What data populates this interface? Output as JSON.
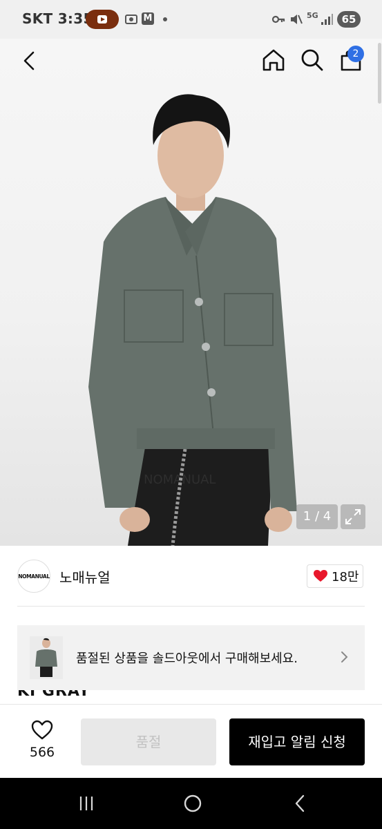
{
  "status_bar": {
    "carrier_time": "SKT 3:35",
    "m_badge": "M",
    "network": "5G",
    "battery": "65"
  },
  "header": {
    "cart_count": "2"
  },
  "gallery": {
    "counter": "1 / 4"
  },
  "brand": {
    "logo_text": "NOMANUAL",
    "name": "노매뉴얼",
    "like_count": "18만",
    "like_color": "#e8172b"
  },
  "product": {
    "title_partial": "KI GRAY"
  },
  "soldout_banner": {
    "text": "품절된 상품을 솔드아웃에서 구매해보세요."
  },
  "actions": {
    "wish_count": "566",
    "soldout_label": "품절",
    "restock_label": "재입고 알림 신청"
  },
  "icons": {
    "back": "chevron-left-icon",
    "home": "home-icon",
    "search": "search-icon",
    "bag": "shopping-bag-icon",
    "expand": "expand-icon",
    "heart": "heart-icon",
    "nav_recent": "recent-apps-icon",
    "nav_home": "home-circle-icon",
    "nav_back": "back-icon"
  }
}
